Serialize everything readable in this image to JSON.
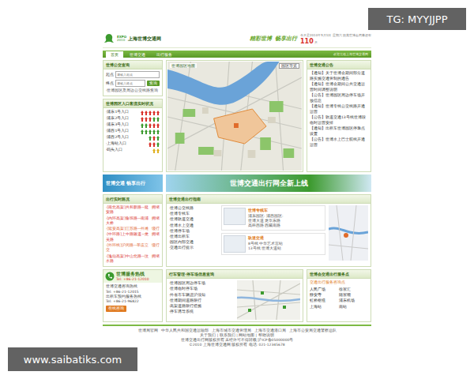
{
  "watermarks": {
    "top": "TG: MYYJJPP",
    "bottom": "www.saibatiks.com"
  },
  "header": {
    "logo_mark": "EXPO",
    "logo_sub": "2010",
    "site_name": "上海世博交通网",
    "slogan": [
      "精彩世博",
      "畅享出行"
    ],
    "info": "今天是2010年5月1日 星期六 距离世博会闭幕还有",
    "countdown": "110",
    "countdown_unit": "天"
  },
  "nav": {
    "tabs": [
      {
        "label": "首页",
        "selected": true
      },
      {
        "label": "世博交通",
        "selected": false
      },
      {
        "label": "出行服务",
        "selected": false
      }
    ],
    "note": "欢迎光临上海世博交通网"
  },
  "search": {
    "title": "世博公交查询",
    "fields": [
      {
        "label": "起点",
        "placeholder": "请输入起点"
      },
      {
        "label": "终点",
        "placeholder": "请输入终点"
      }
    ],
    "button": "查询",
    "note": "·世博园区及周边公交线路查询"
  },
  "entrances": {
    "title": "世博园区入口客流实时状况",
    "items": [
      {
        "name": "·浦东1号入口",
        "arrows": [
          "#d9312b",
          "#d9312b",
          "#d9312b",
          "#d9312b",
          "#d9312b"
        ]
      },
      {
        "name": "·浦东2号入口",
        "arrows": [
          "#d9312b",
          "#d9312b",
          "#d9312b",
          "#3c9a2e",
          "#3c9a2e"
        ]
      },
      {
        "name": "·浦东3号入口",
        "arrows": [
          "#3c9a2e",
          "#3c9a2e",
          "#d9312b",
          "#d9312b",
          "#d9312b"
        ]
      },
      {
        "name": "·浦西1号入口",
        "arrows": [
          "#3c9a2e",
          "#3c9a2e",
          "#3c9a2e",
          "#3c9a2e",
          "#3c9a2e"
        ]
      },
      {
        "name": "·浦西2号入口",
        "arrows": [
          "#3c9a2e",
          "#d9312b",
          "#3c9a2e"
        ]
      },
      {
        "name": "·上海站入口",
        "arrows": [
          "#d9312b",
          "#d9312b",
          "#3c9a2e"
        ]
      },
      {
        "name": "·码头入口",
        "arrows": [
          "#e0b020",
          "#e0b020"
        ]
      }
    ]
  },
  "map": {
    "title": "世博园区地图",
    "badge": "园区导览"
  },
  "notices": {
    "title": "世博交通公告",
    "items": [
      "【通知】关于世博会期间部分道路实施交通管制的通告",
      "【通知】世博会期间公共交通运营时间调整说明",
      "【公告】世博园区周边停车场开放信息",
      "【通知】世博专线公交线路开通运营",
      "【公告】轨道交通13号线世博段临时运营安排",
      "【通知】出租车世博园区停靠点设置",
      "【公告】世博水上巴士航线开通运营"
    ]
  },
  "banners": {
    "left": "世博交通 畅享出行",
    "center": "世博交通出行网全新上线"
  },
  "traffic": {
    "title": "出行实时路况",
    "items": [
      {
        "text": "·[南北高架]共和新路—延安路",
        "status": "拥堵",
        "color": "#d9312b"
      },
      {
        "text": "·[内环高架]鲁班路—南浦大桥",
        "status": "拥堵",
        "color": "#d9312b"
      },
      {
        "text": "·[延安高架]江苏路—外滩",
        "status": "缓行",
        "color": "#e0602b"
      },
      {
        "text": "·[中环路]上中路隧道—龙吴路",
        "status": "拥堵",
        "color": "#d9312b"
      },
      {
        "text": "·[外环线]沪闵路—莘庄立交",
        "status": "缓行",
        "color": "#e0602b"
      },
      {
        "text": "·[逸仙高架]中山北路—汶水路",
        "status": "拥堵",
        "color": "#d9312b"
      }
    ]
  },
  "guide": {
    "title": "世博交通出行指南",
    "links": [
      "·世博公交线路",
      "·世博专线车",
      "·世博轨道交通",
      "·世博水上交通",
      "·世博停车场",
      "·世博出租车",
      "·园区内部交通",
      "·交通出行提示"
    ],
    "cards": [
      {
        "title": "世博专线车",
        "lines": [
          "浦东园区:  浦西园区:",
          "世博大道  龙华东路",
          "高科西路  西藏南路"
        ]
      },
      {
        "title": "轨道交通",
        "lines": [
          "8号线 中华艺术宫站",
          "13号线 世博大道站"
        ]
      }
    ]
  },
  "hotline": {
    "title": "世博服务热线",
    "phone": "Tel: +86-21-12010",
    "lines": [
      "世博交通咨询热线",
      "Tel: +86-21-12015",
      "出租车预约服务热线",
      "Tel: +86-21-96822"
    ],
    "button": "在线咨询"
  },
  "parking": {
    "title": "行车管理·停车场信息查询",
    "links": [
      "·世博园区周边停车场",
      "·世博临时停车场",
      "·外省市车辆进沪须知",
      "·世博期间道路限行",
      "·高架道路限行措施",
      "·停车诱导系统"
    ]
  },
  "services": {
    "title": "世博会交通出行服务点",
    "head": "交通出行服务咨询点",
    "rows": [
      [
        "人民广场",
        "徐家汇"
      ],
      [
        "静安寺",
        "陆家嘴"
      ],
      [
        "虹桥枢纽",
        "浦东机场"
      ],
      [
        "上海站",
        "南站"
      ]
    ]
  },
  "footer": {
    "links": [
      "世博局官网",
      "中华人民共和国交通运输部",
      "上海市城市交通管理局",
      "上海市交通港口局",
      "上海市公安局交通警察总队"
    ],
    "menu": "关于我们 | 联系我们 | 网站地图 | 帮助说明",
    "lines": [
      "世博交通出行网版权所有 未经许可不得转载 沪ICP备05000000号",
      "©2010 上海世博交通网 版权所有 电话: 021-12345678"
    ]
  }
}
